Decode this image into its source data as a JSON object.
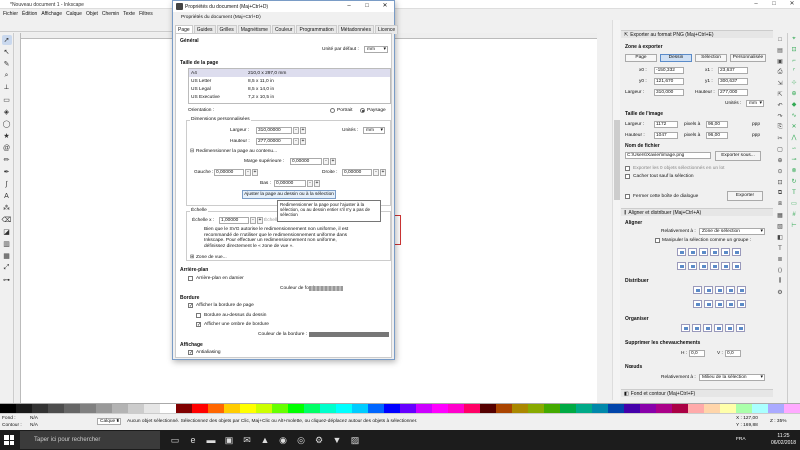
{
  "app": {
    "title": "*Nouveau document 1 - Inkscape",
    "menu": [
      "Fichier",
      "Édition",
      "Affichage",
      "Calque",
      "Objet",
      "Chemin",
      "Texte",
      "Filtres"
    ]
  },
  "dialog": {
    "title": "Propriétés du document (Maj+Ctrl+D)",
    "inner_title": "Propriétés du document (Maj+Ctrl+D)",
    "tabs": [
      "Page",
      "Guides",
      "Grilles",
      "Magnétisme",
      "Couleur",
      "Programmation",
      "Métadonnées",
      "Licence"
    ],
    "general": {
      "heading": "Général",
      "unit_label": "Unité par défaut :",
      "unit_value": "mm"
    },
    "page_size": {
      "heading": "Taille de la page",
      "rows": [
        {
          "name": "A4",
          "size": "210,0 x 297,0 mm"
        },
        {
          "name": "US Letter",
          "size": "8,5 x 11,0 in"
        },
        {
          "name": "US Legal",
          "size": "8,5 x 14,0 in"
        },
        {
          "name": "US Executive",
          "size": "7,2 x 10,5 in"
        }
      ],
      "orientation_label": "Orientation :",
      "portrait": "Portrait",
      "landscape": "Paysage",
      "custom_label": "Dimensions personnalisées",
      "width_label": "Largeur :",
      "width_value": "310,00000",
      "height_label": "Hauteur :",
      "height_value": "277,00000",
      "units_label": "Unités :",
      "units_value": "mm",
      "resize_label": "Redimensionner la page au contenu...",
      "margin_top_label": "Marge supérieure :",
      "margin_top_value": "0,00000",
      "left_label": "Gauche :",
      "left_value": "0,00000",
      "right_label": "Droite :",
      "right_value": "0,00000",
      "bottom_label": "Bas :",
      "bottom_value": "0,00000",
      "resize_button": "Ajuster la page au dessin ou à la sélection"
    },
    "scale": {
      "heading": "Échelle",
      "scale_x_label": "Échelle x :",
      "scale_x_value": "1,00000",
      "user_units_label": "Échelle",
      "note": "Bien que le SVG autorise le redimensionnement non uniforme, il est recommandé de n'utiliser que le redimensionnement uniforme dans Inkscape. Pour effectuer un redimensionnement non uniforme, définissez directement le « zone de vue ».",
      "viewbox_label": "Zone de vue..."
    },
    "background": {
      "heading": "Arrière-plan",
      "checker_label": "Arrière-plan en damier",
      "color_label": "Couleur de fond :"
    },
    "border": {
      "heading": "Bordure",
      "show_border": "Afficher la bordure de page",
      "border_on_top": "Bordure au-dessus du dessin",
      "shadow": "Afficher une ombre de bordure",
      "color_label": "Couleur de la bordure :"
    },
    "display": {
      "heading": "Affichage",
      "antialias": "Antialiasing"
    },
    "tooltip": "Redimensionner la page pour l'ajuster à la sélection, ou au dessin entier s'il n'y a pas de sélection"
  },
  "export": {
    "header": "Exporter au format PNG (Maj+Ctrl+E)",
    "area_label": "Zone à exporter",
    "area_tabs": [
      "Page",
      "Dessin",
      "Sélection",
      "Personnalisée"
    ],
    "x0_label": "x0 :",
    "x0": "-150,332",
    "x1_label": "x1 :",
    "x1": "23,637",
    "y0_label": "y0 :",
    "y0": "121,670",
    "y1_label": "y1 :",
    "y1": "300,637",
    "width_label": "Largeur :",
    "width": "310,000",
    "height_label": "Hauteur :",
    "height": "277,000",
    "units_label": "Unités :",
    "units": "mm",
    "image_size_label": "Taille de l'image",
    "img_width_label": "Largeur :",
    "img_width": "1172",
    "img_height_label": "Hauteur :",
    "img_height": "1047",
    "px_at": "pixels à",
    "dpi1": "96,00",
    "dpi2": "96,00",
    "dpi_unit": "ppp",
    "filename_label": "Nom de fichier",
    "filename": "C:\\Users\\Xavier\\image.png",
    "export_as_button": "Exporter sous...",
    "batch_label": "Exporter les 0 objets sélectionnés en un lot",
    "hide_label": "Cacher tout sauf la sélection",
    "close_label": "Fermer cette boîte de dialogue",
    "export_button": "Exporter"
  },
  "align": {
    "header": "Aligner et distribuer (Maj+Ctrl+A)",
    "align_label": "Aligner",
    "relative_label": "Relativement à :",
    "relative_value": "Zone de sélection",
    "group_label": "Manipuler la sélection comme un groupe :",
    "distribute_label": "Distribuer",
    "organize_label": "Organiser",
    "overlap_label": "Supprimer les chevauchements",
    "h_label": "H :",
    "h_value": "0,0",
    "v_label": "V :",
    "v_value": "0,0",
    "nodes_label": "Nœuds",
    "nodes_relative_label": "Relativement à :",
    "nodes_relative_value": "Milieu de la sélection",
    "fill_header": "Fond et contour (Maj+Ctrl+F)"
  },
  "status": {
    "fill_label": "Fond :",
    "fill_value": "N/A",
    "stroke_label": "Contour :",
    "stroke_value": "N/A",
    "layer": "Calque 1",
    "message": "Aucun objet sélectionné. Sélectionnez des objets par Clic, Maj+Clic ou Alt+molette, ou cliquez-déplacez autour des objets à sélectionner.",
    "x": "X : 127,00",
    "y": "Y : 169,88",
    "zoom": "Z : 35%"
  },
  "taskbar": {
    "search_placeholder": "Taper ici pour rechercher",
    "time": "11:25",
    "date": "06/02/2018",
    "lang": "FRA"
  }
}
